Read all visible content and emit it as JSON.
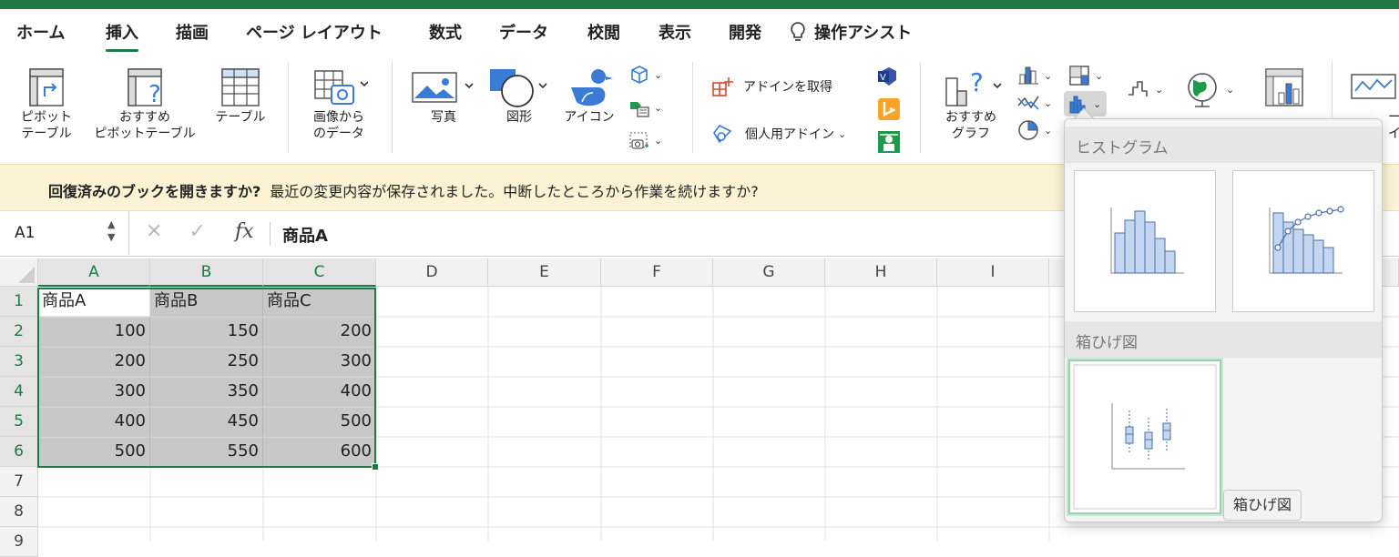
{
  "tabs": [
    {
      "label": "ホーム"
    },
    {
      "label": "挿入"
    },
    {
      "label": "描画"
    },
    {
      "label": "ページ レイアウト"
    },
    {
      "label": "数式"
    },
    {
      "label": "データ"
    },
    {
      "label": "校閲"
    },
    {
      "label": "表示"
    },
    {
      "label": "開発"
    },
    {
      "label": "操作アシスト"
    }
  ],
  "ribbon": {
    "pivot_table": [
      "ピボット",
      "テーブル"
    ],
    "recommended_pivot": [
      "おすすめ",
      "ピボットテーブル"
    ],
    "table": [
      "テーブル"
    ],
    "image_data": [
      "画像から",
      "のデータ"
    ],
    "photo": "写真",
    "shapes": "図形",
    "icons": "アイコン",
    "get_addins": "アドインを取得",
    "my_addins": "個人用アドイン",
    "recommended_charts": [
      "おすすめ",
      "グラフ"
    ],
    "partial_right": [
      "ー",
      "イン"
    ]
  },
  "message_bar": {
    "title": "回復済みのブックを開きますか?",
    "body": "最近の変更内容が保存されました。中断したところから作業を続けますか?"
  },
  "formula_bar": {
    "name_box": "A1",
    "fx": "fx",
    "value": "商品A"
  },
  "sheet": {
    "columns": [
      "A",
      "B",
      "C",
      "D",
      "E",
      "F",
      "G",
      "H",
      "I"
    ],
    "rows": [
      "1",
      "2",
      "3",
      "4",
      "5",
      "6",
      "7",
      "8",
      "9"
    ],
    "cells": [
      [
        "商品A",
        "商品B",
        "商品C"
      ],
      [
        "100",
        "150",
        "200"
      ],
      [
        "200",
        "250",
        "300"
      ],
      [
        "300",
        "350",
        "400"
      ],
      [
        "400",
        "450",
        "500"
      ],
      [
        "500",
        "550",
        "600"
      ]
    ]
  },
  "chart_dropdown": {
    "section_histogram": "ヒストグラム",
    "section_boxplot": "箱ひげ図",
    "tooltip": "箱ひげ図"
  },
  "colors": {
    "accent": "#1f7a46",
    "message_bg": "#fcf3d5",
    "selection_fill": "#c8c8c8",
    "chart_blue": "#c5d7f0"
  }
}
